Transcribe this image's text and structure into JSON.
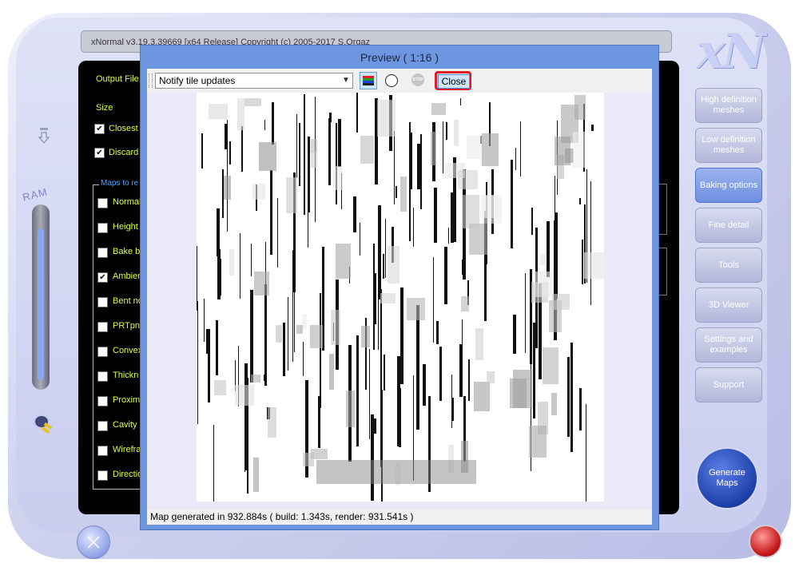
{
  "app": {
    "title": "xNormal v3.19.3.39669 [x64 Release] Copyright (c) 2005-2017 S.Orgaz",
    "logo": "xN",
    "ram_label": "RAM"
  },
  "main_panel": {
    "output_file_label": "Output File",
    "size_label": "Size",
    "closest_label": "Closest h",
    "closest_checked": true,
    "discard_label": "Discard",
    "discard_checked": true,
    "maps_group_title": "Maps to re",
    "maps": [
      {
        "label": "Normal",
        "checked": false
      },
      {
        "label": "Height",
        "checked": false
      },
      {
        "label": "Bake b",
        "checked": false
      },
      {
        "label": "Ambien",
        "checked": true
      },
      {
        "label": "Bent no",
        "checked": false
      },
      {
        "label": "PRTpn",
        "checked": false
      },
      {
        "label": "Convex",
        "checked": false
      },
      {
        "label": "Thickn",
        "checked": false
      },
      {
        "label": "Proximi",
        "checked": false
      },
      {
        "label": "Cavity r",
        "checked": false
      },
      {
        "label": "Wirefra",
        "checked": false
      },
      {
        "label": "Directio",
        "checked": false
      }
    ]
  },
  "sidebar": {
    "buttons": [
      {
        "label": "High definition meshes",
        "active": false
      },
      {
        "label": "Low definition meshes",
        "active": false
      },
      {
        "label": "Baking options",
        "active": true
      },
      {
        "label": "Fine detail",
        "active": false
      },
      {
        "label": "Tools",
        "active": false
      },
      {
        "label": "3D Viewer",
        "active": false
      },
      {
        "label": "Settings and examples",
        "active": false
      },
      {
        "label": "Support",
        "active": false
      }
    ],
    "generate_label": "Generate Maps"
  },
  "preview": {
    "title": "Preview ( 1:16 )",
    "dropdown_value": "Notify tile updates",
    "stop_label": "STOP",
    "close_label": "Close",
    "status": "Map generated in 932.884s ( build: 1.343s, render: 931.541s )"
  },
  "colors": {
    "label_green": "#dcff3c",
    "group_blue": "#4fa3ff",
    "close_highlight": "#e01c24",
    "preview_frame": "#6d96e0"
  }
}
